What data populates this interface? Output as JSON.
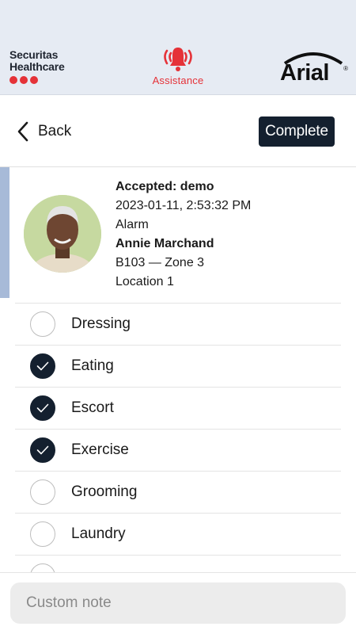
{
  "header": {
    "brand_line1": "Securitas",
    "brand_line2": "Healthcare",
    "assistance_label": "Assistance",
    "logo_text": "Arial",
    "logo_mark": "®",
    "accent_color": "#e53238"
  },
  "nav": {
    "back_label": "Back",
    "complete_label": "Complete"
  },
  "resident": {
    "accepted": "Accepted: demo",
    "timestamp": "2023-01-11, 2:53:32 PM",
    "type": "Alarm",
    "name": "Annie Marchand",
    "room": "B103 — Zone 3",
    "location": "Location 1"
  },
  "tasks": [
    {
      "label": "Dressing",
      "checked": false
    },
    {
      "label": "Eating",
      "checked": true
    },
    {
      "label": "Escort",
      "checked": true
    },
    {
      "label": "Exercise",
      "checked": true
    },
    {
      "label": "Grooming",
      "checked": false
    },
    {
      "label": "Laundry",
      "checked": false
    },
    {
      "label": "",
      "checked": false
    }
  ],
  "note": {
    "placeholder": "Custom note",
    "value": ""
  }
}
